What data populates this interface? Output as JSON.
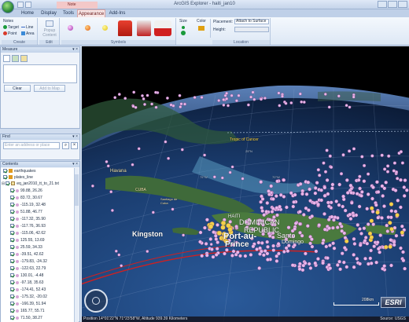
{
  "window": {
    "title": "ArcGIS Explorer - haiti_jan10",
    "contextual_tab_label": "Note"
  },
  "tabs": [
    {
      "label": "Home"
    },
    {
      "label": "Display"
    },
    {
      "label": "Tools"
    },
    {
      "label": "Appearance",
      "active": true
    },
    {
      "label": "Add-Ins"
    }
  ],
  "ribbon": {
    "create": {
      "title": "Notes",
      "items": [
        "Target",
        "Line",
        "Point",
        "Area"
      ],
      "group_label": "Create"
    },
    "edit": {
      "popup_label": "Popup Content",
      "group_label": "Edit"
    },
    "symbols": {
      "group_label": "Symbols"
    },
    "size": {
      "title": "Size"
    },
    "color": {
      "title": "Color"
    },
    "location": {
      "placement_label": "Placement:",
      "placement_value": "Attach to Surface",
      "height_label": "Height:",
      "group_label": "Location"
    }
  },
  "measure": {
    "header": "Measure",
    "clear_label": "Clear",
    "add_to_map_label": "Add to Map"
  },
  "find": {
    "header": "Find",
    "placeholder": "Enter an address or place"
  },
  "contents": {
    "header": "Contents",
    "layers": [
      {
        "label": "earthquakes"
      },
      {
        "label": "plates_line"
      },
      {
        "label": "eq_jan2010_tt_to_21.txt"
      }
    ],
    "points": [
      "99.88, 26.26",
      "83.72, 30.67",
      "-115.19, 32.48",
      "51.88, 46.77",
      "-117.32, 35.90",
      "-117.76, 36.93",
      "-115.06, 42.62",
      "125.55, 13.69",
      "25.59, 34.33",
      "-39.51, 42.62",
      "-179.83, -24.32",
      "-122.63, 22.79",
      "130.01, -4.48",
      "-97.18, 35.63",
      "-174.41, 52.43",
      "-175.32, -20.02",
      "-166.39, 51.94",
      "165.77, 55.71",
      "71.50, 38.27"
    ]
  },
  "map": {
    "labels": {
      "tropic": "Tropic of Cancer",
      "havana": "Havana",
      "cuba": "CUBA",
      "santiago": "Santiago de Cuba",
      "haiti": "HAITI",
      "dominican": "DOMINICAN",
      "republic": "REPUBLIC",
      "port": "Port-au-",
      "prince": "Prince",
      "santo": "Santo",
      "domingo": "Domingo",
      "kingston": "Kingston",
      "lat_25": "25°N",
      "lon_75": "75°W",
      "lon_70": "70°W"
    },
    "scale_label": "208km",
    "logo": "ESRI",
    "status": "Position 14°01'22\"N 71°23'58\"W, Altitude 939.39 Kilometers",
    "source": "Source: USGS"
  },
  "colors": {
    "ribbon_bg": "#dde8f5",
    "panel_bg": "#eef3fa",
    "quake_points": "#e8b6ea",
    "plate_line": "#d02020"
  }
}
